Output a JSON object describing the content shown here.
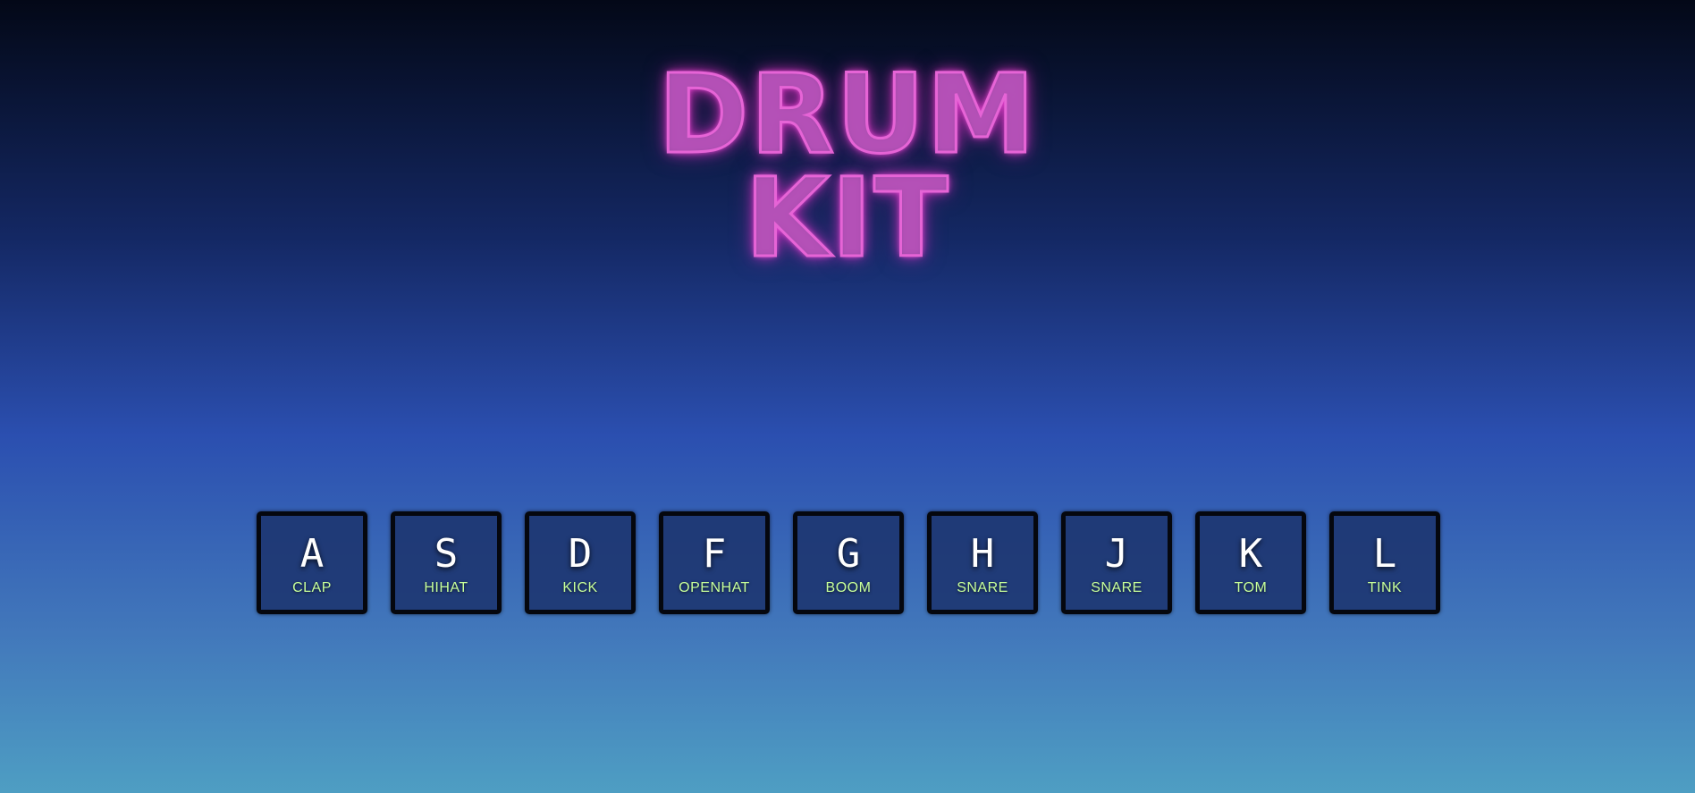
{
  "title": {
    "line1": "DRUM",
    "line2": "KIT"
  },
  "keys": [
    {
      "letter": "A",
      "sound": "CLAP"
    },
    {
      "letter": "S",
      "sound": "HIHAT"
    },
    {
      "letter": "D",
      "sound": "KICK"
    },
    {
      "letter": "F",
      "sound": "OPENHAT"
    },
    {
      "letter": "G",
      "sound": "BOOM"
    },
    {
      "letter": "H",
      "sound": "SNARE"
    },
    {
      "letter": "J",
      "sound": "SNARE"
    },
    {
      "letter": "K",
      "sound": "TOM"
    },
    {
      "letter": "L",
      "sound": "TINK"
    }
  ],
  "colors": {
    "title_glow": "#e664d6",
    "sound_label": "#c7ff9a",
    "key_border": "#05070e"
  }
}
